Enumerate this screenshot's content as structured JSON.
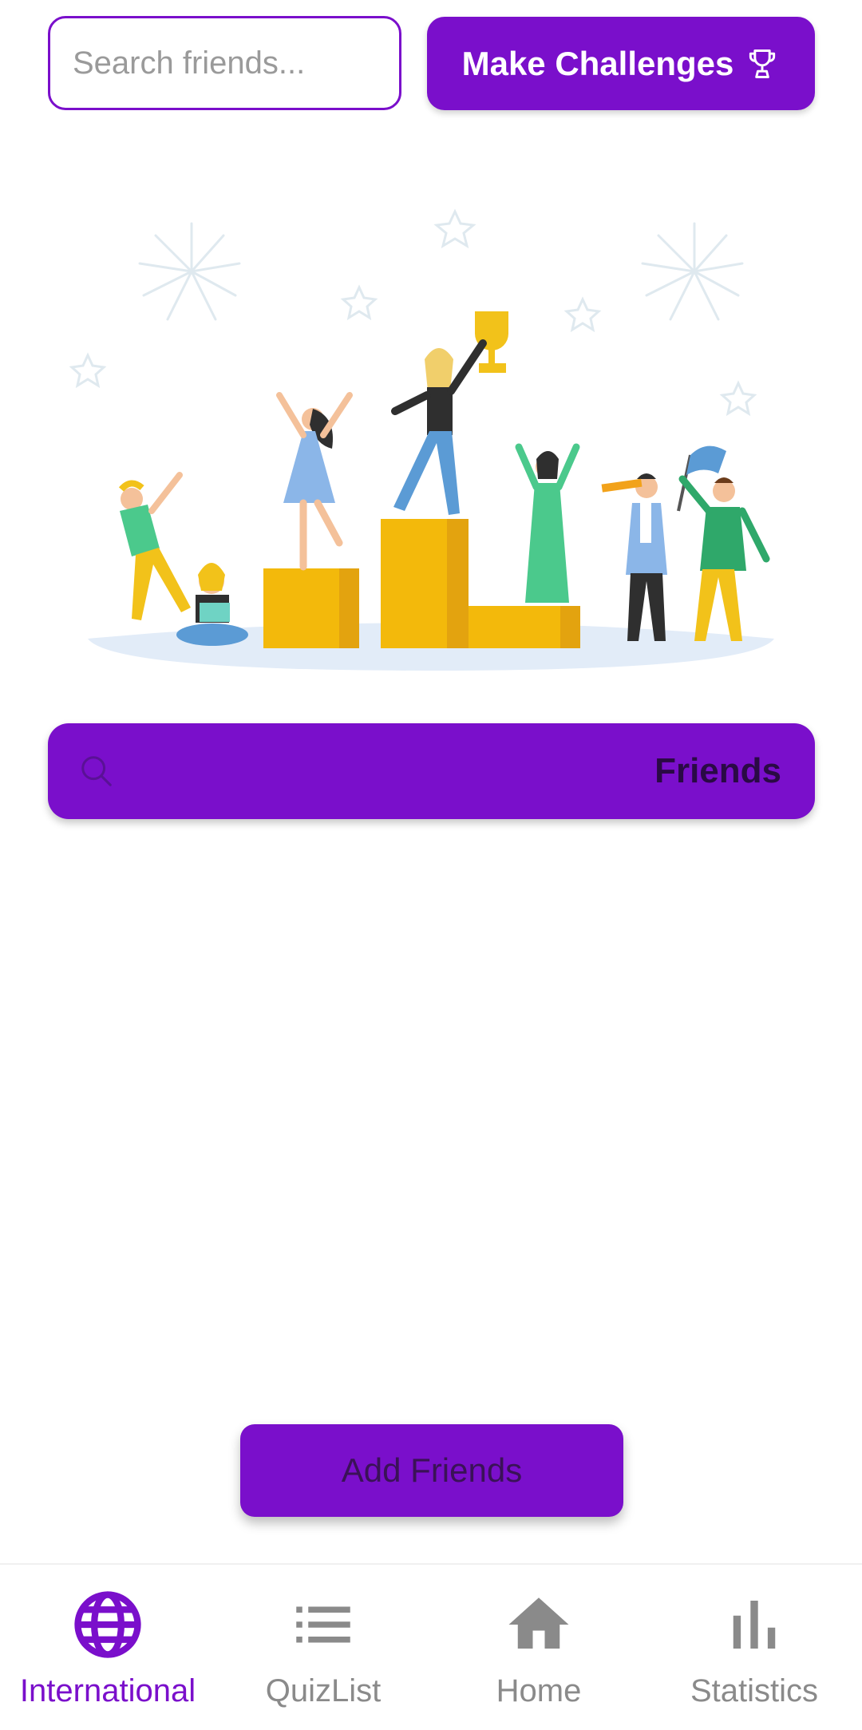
{
  "top": {
    "search_placeholder": "Search friends...",
    "challenge_label": "Make Challenges",
    "challenge_icon": "trophy-icon"
  },
  "friends_bar": {
    "title": "Friends",
    "icon": "search-icon"
  },
  "add_button_label": "Add Friends",
  "nav": {
    "items": [
      {
        "label": "International",
        "icon": "globe-icon",
        "active": true
      },
      {
        "label": "QuizList",
        "icon": "list-icon",
        "active": false
      },
      {
        "label": "Home",
        "icon": "home-icon",
        "active": false
      },
      {
        "label": "Statistics",
        "icon": "bar-chart-icon",
        "active": false
      }
    ]
  },
  "colors": {
    "accent": "#7a0fcb",
    "inactive": "#8a8a8a",
    "podium": "#f3b90b"
  }
}
